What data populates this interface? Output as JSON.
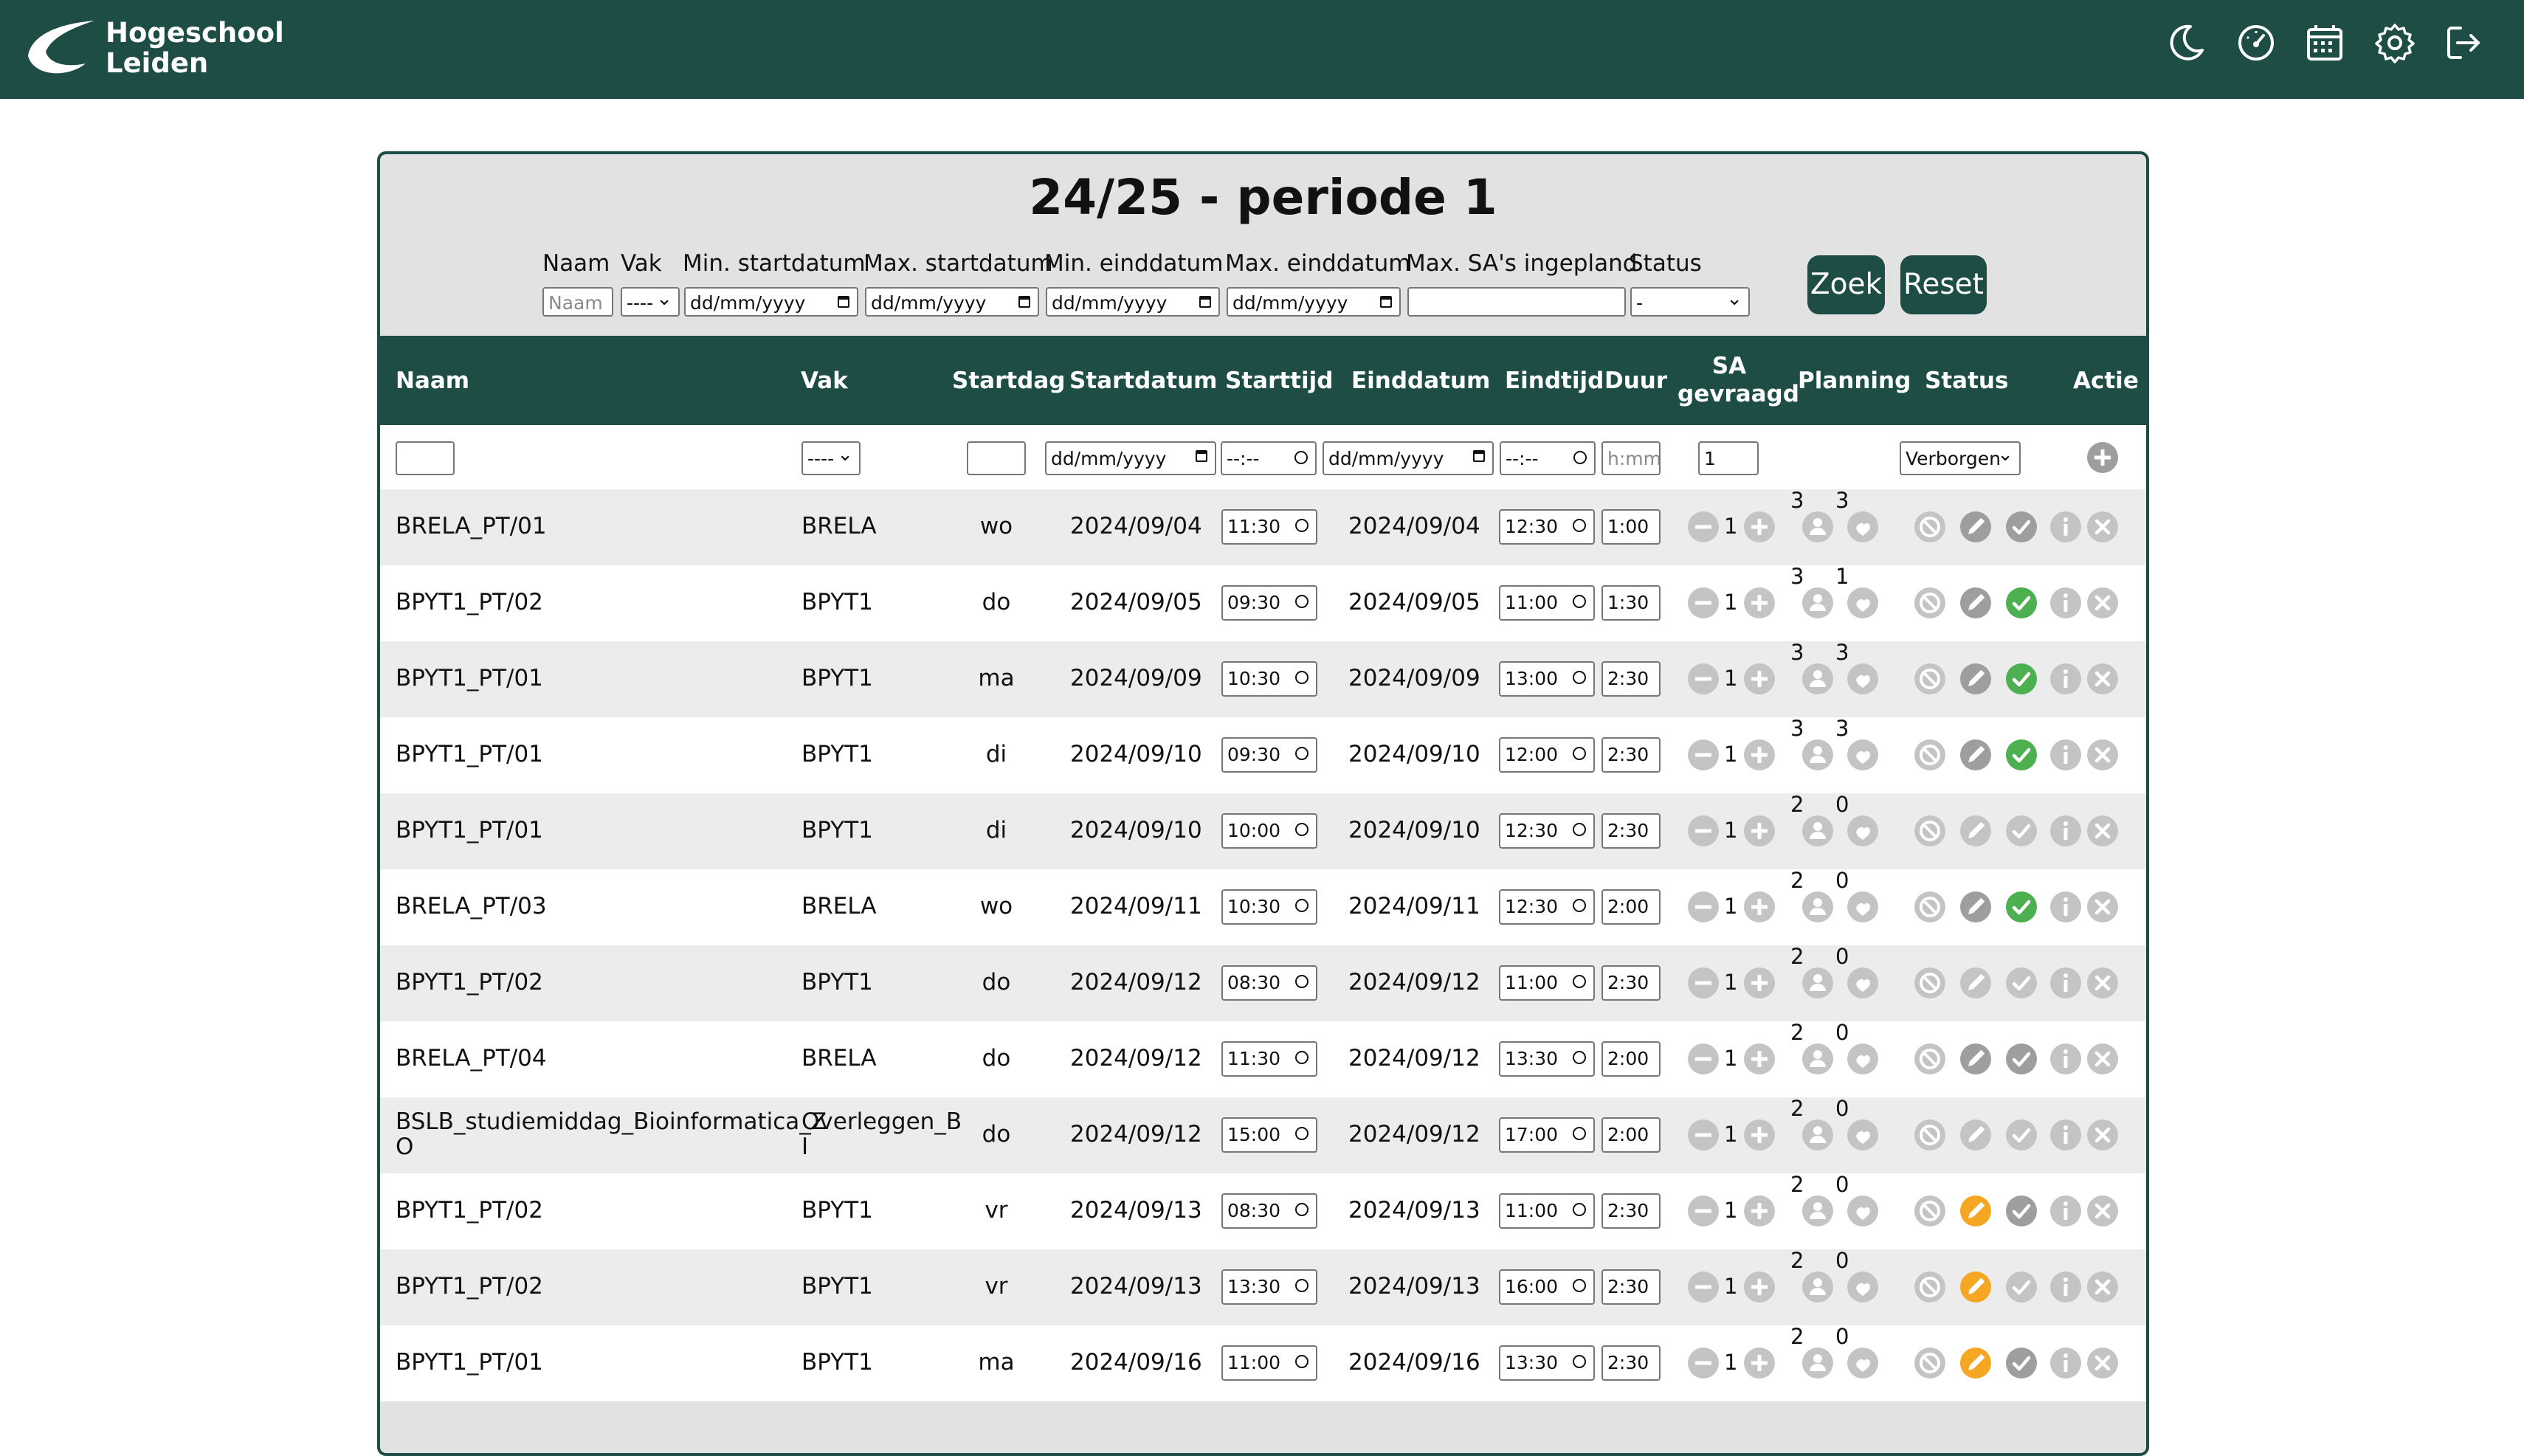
{
  "header": {
    "brand_line1": "Hogeschool",
    "brand_line2": "Leiden",
    "icons": [
      "moon-icon",
      "dashboard-icon",
      "calendar-icon",
      "gear-icon",
      "logout-icon"
    ]
  },
  "panel": {
    "title": "24/25 - periode 1"
  },
  "filters": {
    "naam_label": "Naam",
    "naam_placeholder": "Naam",
    "vak_label": "Vak",
    "vak_value": "----",
    "min_start_label": "Min. startdatum",
    "max_start_label": "Max. startdatum",
    "min_eind_label": "Min. einddatum",
    "max_eind_label": "Max. einddatum",
    "date_placeholder": "dd/mm/yyyy",
    "max_sa_label": "Max. SA's ingepland",
    "status_label": "Status",
    "status_value": "-",
    "zoek": "Zoek",
    "reset": "Reset"
  },
  "columns": {
    "naam": "Naam",
    "vak": "Vak",
    "startdag": "Startdag",
    "startdatum": "Startdatum",
    "starttijd": "Starttijd",
    "einddatum": "Einddatum",
    "eindtijd": "Eindtijd",
    "duur": "Duur",
    "sa_line1": "SA",
    "sa_line2": "gevraagd",
    "planning": "Planning",
    "status": "Status",
    "actie": "Actie"
  },
  "new_row": {
    "vak_value": "----",
    "date_placeholder": "dd/mm/yyyy",
    "time_placeholder": "--:--",
    "duur_placeholder": "h:mm",
    "sa_value": "1",
    "status_value": "Verborgen"
  },
  "rows": [
    {
      "naam": "BRELA_PT/01",
      "vak": "BRELA",
      "startdag": "wo",
      "startdatum": "2024/09/04",
      "starttijd": "11:30",
      "einddatum": "2024/09/04",
      "eindtijd": "12:30",
      "duur": "1:00",
      "sa": "1",
      "plan_a": "3",
      "plan_b": "3",
      "pen": "gray",
      "check": "gray"
    },
    {
      "naam": "BPYT1_PT/02",
      "vak": "BPYT1",
      "startdag": "do",
      "startdatum": "2024/09/05",
      "starttijd": "09:30",
      "einddatum": "2024/09/05",
      "eindtijd": "11:00",
      "duur": "1:30",
      "sa": "1",
      "plan_a": "3",
      "plan_b": "1",
      "pen": "gray",
      "check": "green"
    },
    {
      "naam": "BPYT1_PT/01",
      "vak": "BPYT1",
      "startdag": "ma",
      "startdatum": "2024/09/09",
      "starttijd": "10:30",
      "einddatum": "2024/09/09",
      "eindtijd": "13:00",
      "duur": "2:30",
      "sa": "1",
      "plan_a": "3",
      "plan_b": "3",
      "pen": "gray",
      "check": "green"
    },
    {
      "naam": "BPYT1_PT/01",
      "vak": "BPYT1",
      "startdag": "di",
      "startdatum": "2024/09/10",
      "starttijd": "09:30",
      "einddatum": "2024/09/10",
      "eindtijd": "12:00",
      "duur": "2:30",
      "sa": "1",
      "plan_a": "3",
      "plan_b": "3",
      "pen": "gray",
      "check": "green"
    },
    {
      "naam": "BPYT1_PT/01",
      "vak": "BPYT1",
      "startdag": "di",
      "startdatum": "2024/09/10",
      "starttijd": "10:00",
      "einddatum": "2024/09/10",
      "eindtijd": "12:30",
      "duur": "2:30",
      "sa": "1",
      "plan_a": "2",
      "plan_b": "0",
      "pen": "lightgray",
      "check": "lightgray"
    },
    {
      "naam": "BRELA_PT/03",
      "vak": "BRELA",
      "startdag": "wo",
      "startdatum": "2024/09/11",
      "starttijd": "10:30",
      "einddatum": "2024/09/11",
      "eindtijd": "12:30",
      "duur": "2:00",
      "sa": "1",
      "plan_a": "2",
      "plan_b": "0",
      "pen": "gray",
      "check": "green"
    },
    {
      "naam": "BPYT1_PT/02",
      "vak": "BPYT1",
      "startdag": "do",
      "startdatum": "2024/09/12",
      "starttijd": "08:30",
      "einddatum": "2024/09/12",
      "eindtijd": "11:00",
      "duur": "2:30",
      "sa": "1",
      "plan_a": "2",
      "plan_b": "0",
      "pen": "lightgray",
      "check": "lightgray"
    },
    {
      "naam": "BRELA_PT/04",
      "vak": "BRELA",
      "startdag": "do",
      "startdatum": "2024/09/12",
      "starttijd": "11:30",
      "einddatum": "2024/09/12",
      "eindtijd": "13:30",
      "duur": "2:00",
      "sa": "1",
      "plan_a": "2",
      "plan_b": "0",
      "pen": "gray",
      "check": "gray"
    },
    {
      "naam": "BSLB_studiemiddag_Bioinformatica_Z",
      "naam2": "O",
      "vak": "Overleggen_B",
      "vak2": "I",
      "startdag": "do",
      "startdatum": "2024/09/12",
      "starttijd": "15:00",
      "einddatum": "2024/09/12",
      "eindtijd": "17:00",
      "duur": "2:00",
      "sa": "1",
      "plan_a": "2",
      "plan_b": "0",
      "pen": "lightgray",
      "check": "lightgray"
    },
    {
      "naam": "BPYT1_PT/02",
      "vak": "BPYT1",
      "startdag": "vr",
      "startdatum": "2024/09/13",
      "starttijd": "08:30",
      "einddatum": "2024/09/13",
      "eindtijd": "11:00",
      "duur": "2:30",
      "sa": "1",
      "plan_a": "2",
      "plan_b": "0",
      "pen": "orange",
      "check": "gray"
    },
    {
      "naam": "BPYT1_PT/02",
      "vak": "BPYT1",
      "startdag": "vr",
      "startdatum": "2024/09/13",
      "starttijd": "13:30",
      "einddatum": "2024/09/13",
      "eindtijd": "16:00",
      "duur": "2:30",
      "sa": "1",
      "plan_a": "2",
      "plan_b": "0",
      "pen": "orange",
      "check": "lightgray"
    },
    {
      "naam": "BPYT1_PT/01",
      "vak": "BPYT1",
      "startdag": "ma",
      "startdatum": "2024/09/16",
      "starttijd": "11:00",
      "einddatum": "2024/09/16",
      "eindtijd": "13:30",
      "duur": "2:30",
      "sa": "1",
      "plan_a": "2",
      "plan_b": "0",
      "pen": "orange",
      "check": "gray"
    }
  ],
  "colors": {
    "brand": "#1d4d45",
    "green": "#4caf50",
    "orange": "#f5a623",
    "gray": "#9e9e9e",
    "lightgray": "#c4c4c4"
  }
}
